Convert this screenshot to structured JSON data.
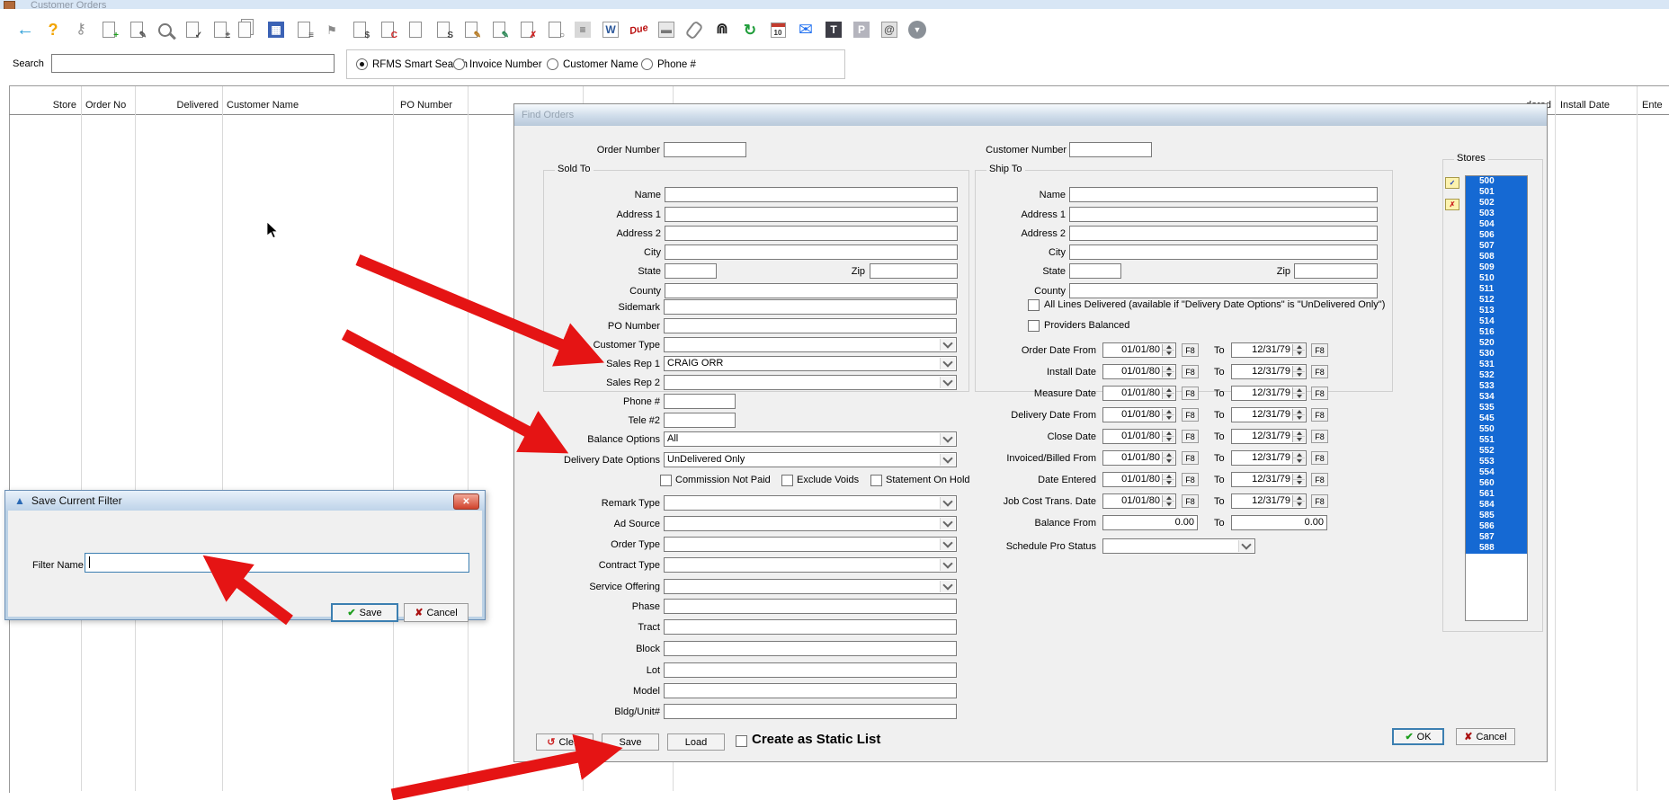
{
  "colors": {
    "selection_blue": "#1569d3",
    "arrow_red": "#e51414",
    "default_button_border": "#3c7fb1",
    "title_gradient_blue": "#bed3e9"
  },
  "window": {
    "title": "Customer Orders"
  },
  "toolbar": {
    "icons": [
      {
        "name": "back-icon",
        "kind": "glyph",
        "glyph": "←",
        "color": "#2b9fd8",
        "fs": 20,
        "bold": true
      },
      {
        "name": "help-icon",
        "kind": "glyph",
        "glyph": "?",
        "color": "#f2a400",
        "fs": 18,
        "bold": true
      },
      {
        "name": "key-icon",
        "kind": "glyph",
        "glyph": "⚷",
        "color": "#8f8f8f",
        "fs": 16,
        "bold": false
      },
      {
        "name": "new-order-icon",
        "kind": "doc",
        "glyph": "+",
        "color": "#1b9e1b"
      },
      {
        "name": "edit-order-icon",
        "kind": "doc",
        "glyph": "✎",
        "color": "#555555"
      },
      {
        "name": "search-order-icon",
        "kind": "mag",
        "glyph": "",
        "color": ""
      },
      {
        "name": "view-order-icon",
        "kind": "doc",
        "glyph": "✓",
        "color": "#444444"
      },
      {
        "name": "adjust-order-icon",
        "kind": "doc",
        "glyph": "±",
        "color": "#444444"
      },
      {
        "name": "copy-order-icon",
        "kind": "doc2",
        "glyph": "",
        "color": ""
      },
      {
        "name": "batch-orders-icon",
        "kind": "square",
        "glyph": "▦",
        "color": "#ffffff",
        "bg": "#3b62b5"
      },
      {
        "name": "order-form-icon",
        "kind": "doc",
        "glyph": "≡",
        "color": "#444444"
      },
      {
        "name": "flag-icon",
        "kind": "glyph",
        "glyph": "⚑",
        "color": "#8a8a8a",
        "fs": 13,
        "bold": false
      },
      {
        "name": "receipt-icon",
        "kind": "doc",
        "glyph": "$",
        "color": "#444444"
      },
      {
        "name": "credit-memo-icon",
        "kind": "doc",
        "glyph": "C",
        "color": "#cc2222"
      },
      {
        "name": "document-icon",
        "kind": "doc",
        "glyph": "",
        "color": ""
      },
      {
        "name": "invoice-icon",
        "kind": "doc",
        "glyph": "S",
        "color": "#444444"
      },
      {
        "name": "write-order-icon",
        "kind": "doc",
        "glyph": "✎",
        "color": "#b7791f"
      },
      {
        "name": "modify-order-icon",
        "kind": "doc",
        "glyph": "✎",
        "color": "#2a8855"
      },
      {
        "name": "void-order-icon",
        "kind": "doc",
        "glyph": "✗",
        "color": "#cc2222"
      },
      {
        "name": "preview-order-icon",
        "kind": "doc",
        "glyph": "○",
        "color": "#444444"
      },
      {
        "name": "print-icon",
        "kind": "square",
        "glyph": "≡",
        "color": "#555555",
        "bg": "#d8d8d8"
      },
      {
        "name": "word-export-icon",
        "kind": "square",
        "glyph": "W",
        "color": "#2b579a",
        "bg": "#ffffff",
        "bd": true
      },
      {
        "name": "due-icon",
        "kind": "due",
        "glyph": "Due",
        "color": "#bb1111"
      },
      {
        "name": "payment-icon",
        "kind": "square",
        "glyph": "▬",
        "color": "#777777",
        "bg": "#e8e8e8",
        "bd": true
      },
      {
        "name": "attachment-icon",
        "kind": "clip",
        "glyph": "",
        "color": ""
      },
      {
        "name": "binoculars-find-icon",
        "kind": "glyph",
        "glyph": "⋒",
        "color": "#222222",
        "fs": 16,
        "bold": true
      },
      {
        "name": "refresh-icon",
        "kind": "glyph",
        "glyph": "↻",
        "color": "#1f9d3a",
        "fs": 17,
        "bold": true
      },
      {
        "name": "calendar-icon",
        "kind": "cal",
        "glyph": "10",
        "color": "#333333"
      },
      {
        "name": "email-icon",
        "kind": "glyph",
        "glyph": "✉",
        "color": "#1f6ff0",
        "fs": 19,
        "bold": false
      },
      {
        "name": "text-export-icon",
        "kind": "square",
        "glyph": "T",
        "color": "#ffffff",
        "bg": "#3d3d46"
      },
      {
        "name": "pdf-export-icon",
        "kind": "square",
        "glyph": "P",
        "color": "#ffffff",
        "bg": "#b4b4bd"
      },
      {
        "name": "contacts-icon",
        "kind": "square",
        "glyph": "@",
        "color": "#555555",
        "bg": "#e2e2e2",
        "bd": true
      },
      {
        "name": "download-icon",
        "kind": "circle",
        "glyph": "▼",
        "color": "#ffffff",
        "bg": "#8a9097"
      }
    ]
  },
  "search": {
    "label": "Search",
    "value": "",
    "radios": [
      {
        "label": "RFMS Smart Search",
        "selected": true
      },
      {
        "label": "Invoice Number",
        "selected": false
      },
      {
        "label": "Customer Name",
        "selected": false
      },
      {
        "label": "Phone #",
        "selected": false
      }
    ]
  },
  "table": {
    "left_columns": [
      {
        "label": "Store"
      },
      {
        "label": "Order No"
      },
      {
        "label": "Delivered"
      },
      {
        "label": "Customer Name"
      },
      {
        "label": "PO Number"
      }
    ],
    "right_columns": [
      {
        "label": "dered"
      },
      {
        "label": "Install Date"
      },
      {
        "label": "Ente"
      }
    ]
  },
  "find_orders": {
    "title": "Find Orders",
    "order_number": {
      "label": "Order Number",
      "value": ""
    },
    "customer_number": {
      "label": "Customer Number",
      "value": ""
    },
    "sold_to": {
      "title": "Sold To",
      "fields": [
        "Name",
        "Address 1",
        "Address 2",
        "City",
        "State",
        "Zip",
        "County"
      ]
    },
    "ship_to": {
      "title": "Ship To",
      "fields": [
        "Name",
        "Address 1",
        "Address 2",
        "City",
        "State",
        "Zip",
        "County"
      ]
    },
    "mid_fields": [
      {
        "label": "Sidemark",
        "type": "text",
        "value": ""
      },
      {
        "label": "PO Number",
        "type": "text",
        "value": ""
      },
      {
        "label": "Customer Type",
        "type": "select",
        "value": ""
      },
      {
        "label": "Sales Rep 1",
        "type": "select",
        "value": "CRAIG ORR"
      },
      {
        "label": "Sales Rep 2",
        "type": "select",
        "value": ""
      },
      {
        "label": "Phone #",
        "type": "small",
        "value": ""
      },
      {
        "label": "Tele #2",
        "type": "small",
        "value": ""
      },
      {
        "label": "Balance Options",
        "type": "select",
        "value": "All"
      },
      {
        "label": "Delivery Date Options",
        "type": "select",
        "value": "UnDelivered Only"
      }
    ],
    "mid_checkboxes": [
      "Commission Not Paid",
      "Exclude Voids",
      "Statement On Hold"
    ],
    "lower_fields": [
      {
        "label": "Remark Type",
        "type": "select",
        "value": ""
      },
      {
        "label": "Ad Source",
        "type": "select",
        "value": ""
      },
      {
        "label": "Order Type",
        "type": "select",
        "value": ""
      },
      {
        "label": "Contract Type",
        "type": "select",
        "value": ""
      },
      {
        "label": "Service Offering",
        "type": "select",
        "value": ""
      },
      {
        "label": "Phase",
        "type": "text",
        "value": ""
      },
      {
        "label": "Tract",
        "type": "text",
        "value": ""
      },
      {
        "label": "Block",
        "type": "text",
        "value": ""
      },
      {
        "label": "Lot",
        "type": "text",
        "value": ""
      },
      {
        "label": "Model",
        "type": "text",
        "value": ""
      },
      {
        "label": "Bldg/Unit#",
        "type": "text",
        "value": ""
      }
    ],
    "right": {
      "all_lines_label": "All Lines Delivered (available if \"Delivery Date Options\" is \"UnDelivered Only\")",
      "providers_label": "Providers Balanced",
      "date_rows": [
        "Order Date From",
        "Install Date",
        "Measure Date",
        "Delivery Date From",
        "Close Date",
        "Invoiced/Billed From",
        "Date Entered",
        "Job Cost Trans. Date"
      ],
      "date_from": "01/01/80",
      "date_to": "12/31/79",
      "f8": "F8",
      "to_label": "To",
      "balance": {
        "label": "Balance From",
        "from": "0.00",
        "to": "0.00"
      },
      "schedule": {
        "label": "Schedule Pro Status",
        "value": ""
      }
    },
    "stores": {
      "title": "Stores",
      "items": [
        "500",
        "501",
        "502",
        "503",
        "504",
        "506",
        "507",
        "508",
        "509",
        "510",
        "511",
        "512",
        "513",
        "514",
        "516",
        "520",
        "530",
        "531",
        "532",
        "533",
        "534",
        "535",
        "545",
        "550",
        "551",
        "552",
        "553",
        "554",
        "560",
        "561",
        "584",
        "585",
        "586",
        "587",
        "588"
      ]
    },
    "buttons": {
      "clear": "Clear",
      "save": "Save",
      "load": "Load",
      "static_list": "Create as Static List",
      "ok": "OK",
      "cancel": "Cancel"
    }
  },
  "save_filter": {
    "title": "Save Current Filter",
    "field_label": "Filter Name",
    "value": "",
    "save": "Save",
    "cancel": "Cancel"
  }
}
